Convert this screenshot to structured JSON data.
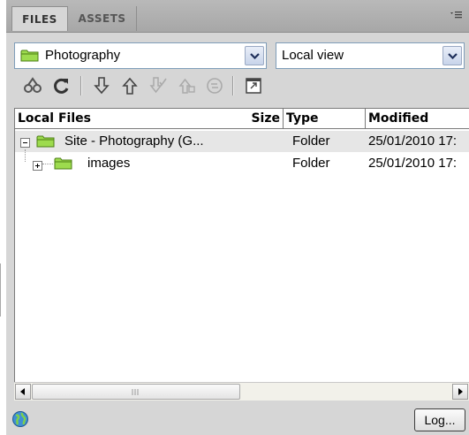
{
  "tabs": [
    {
      "label": "FILES",
      "active": true
    },
    {
      "label": "ASSETS",
      "active": false
    }
  ],
  "site_select": {
    "value": "Photography",
    "icon": "folder-icon"
  },
  "view_select": {
    "value": "Local view"
  },
  "toolbar": {
    "buttons": [
      "connect-icon",
      "refresh-icon",
      "get-icon",
      "put-icon",
      "check-out-icon",
      "check-in-icon",
      "synchronize-icon",
      "expand-icon"
    ]
  },
  "columns": {
    "name": "Local Files",
    "size": "Size",
    "type": "Type",
    "modified": "Modified"
  },
  "rows": [
    {
      "name": "Site - Photography (G...",
      "size": "",
      "type": "Folder",
      "modified": "25/01/2010 17:",
      "expanded": true,
      "selected": true
    },
    {
      "name": "images",
      "size": "",
      "type": "Folder",
      "modified": "25/01/2010 17:",
      "expanded": false,
      "selected": false
    }
  ],
  "status": {
    "log_label": "Log..."
  },
  "colors": {
    "panel": "#d6d6d6",
    "tabstrip": "#b0b0b0",
    "selected_row": "#e6e6e6",
    "folder": "#6fbf1f"
  }
}
